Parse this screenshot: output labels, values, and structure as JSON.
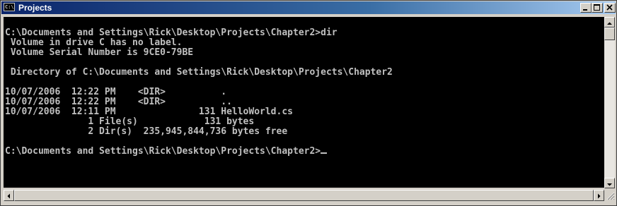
{
  "window": {
    "title": "Projects",
    "icon": "console-icon",
    "icon_text": "C:\\"
  },
  "caption_buttons": [
    "minimize-icon",
    "maximize-icon",
    "close-icon"
  ],
  "console": {
    "lines": [
      "",
      "C:\\Documents and Settings\\Rick\\Desktop\\Projects\\Chapter2>dir",
      " Volume in drive C has no label.",
      " Volume Serial Number is 9CE0-79BE",
      "",
      " Directory of C:\\Documents and Settings\\Rick\\Desktop\\Projects\\Chapter2",
      "",
      "10/07/2006  12:22 PM    <DIR>          .",
      "10/07/2006  12:22 PM    <DIR>          ..",
      "10/07/2006  12:11 PM               131 HelloWorld.cs",
      "               1 File(s)            131 bytes",
      "               2 Dir(s)  235,945,844,736 bytes free",
      "",
      "C:\\Documents and Settings\\Rick\\Desktop\\Projects\\Chapter2>"
    ],
    "text_color": "#c0c0c0",
    "background": "#000000"
  },
  "colors": {
    "titlebar_start": "#0a246a",
    "titlebar_end": "#a6caf0",
    "chrome": "#d4d0c8"
  }
}
